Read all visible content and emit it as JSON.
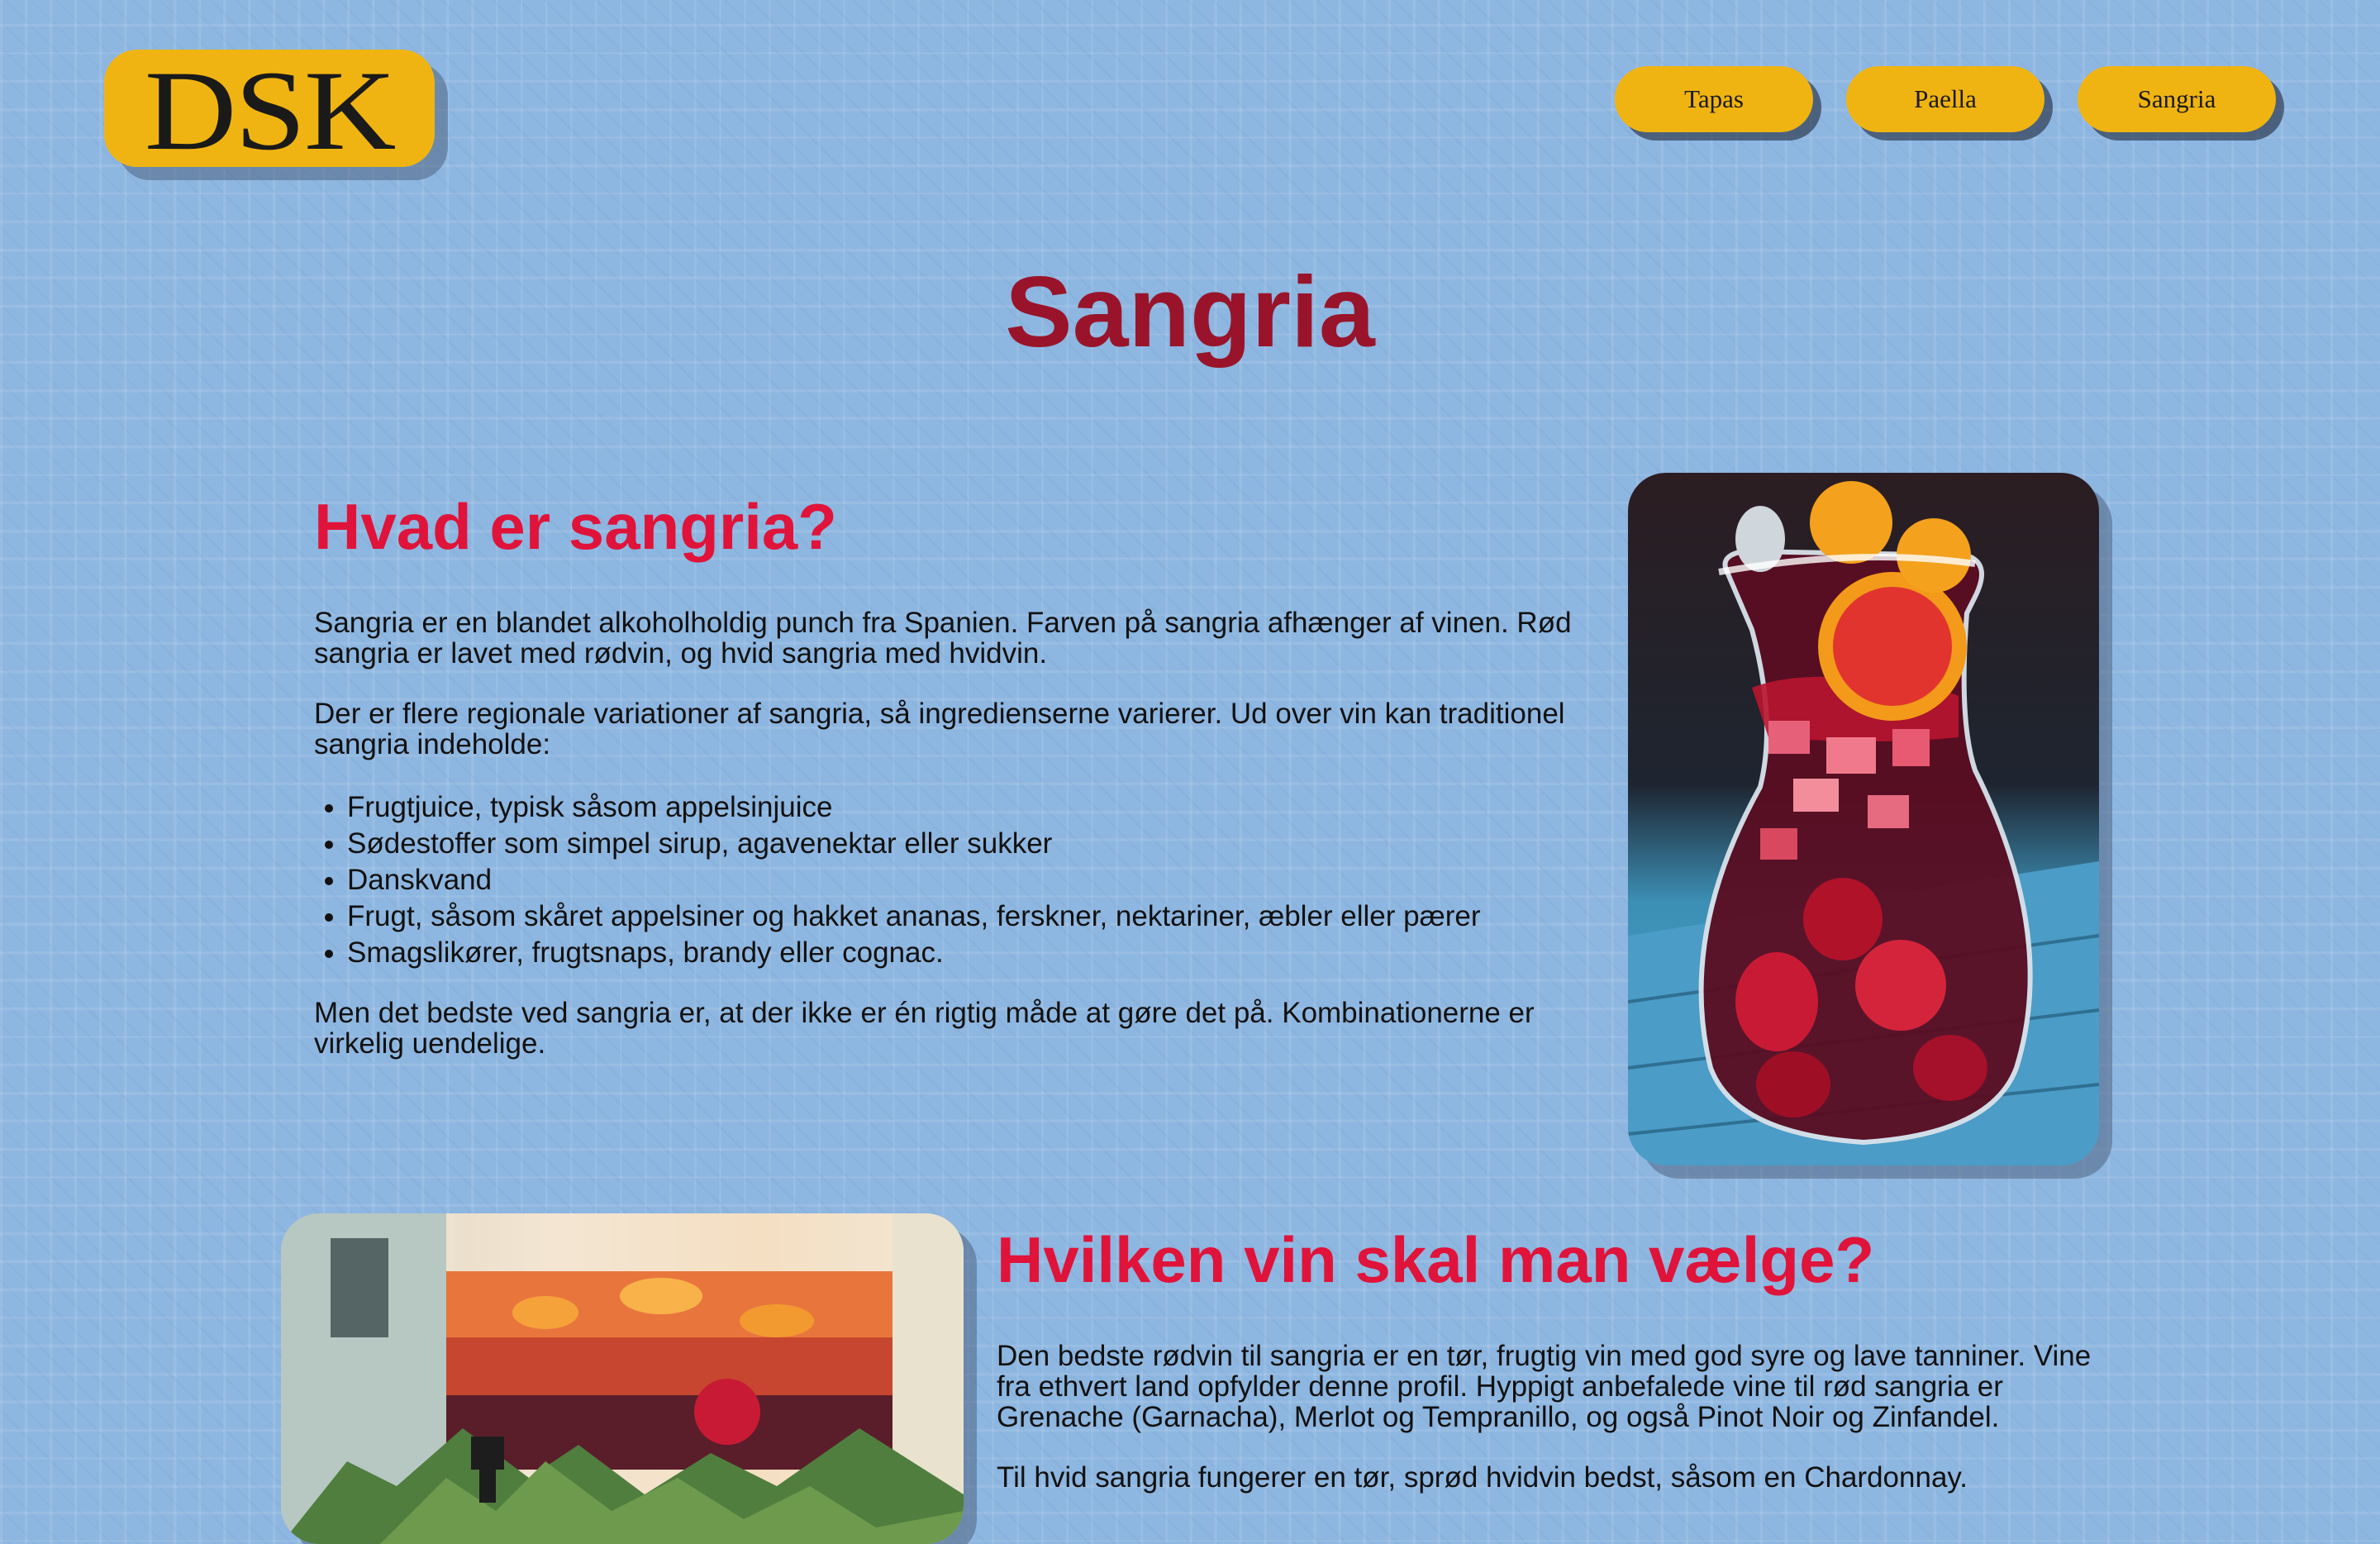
{
  "header": {
    "logo_text": "DSK",
    "nav": [
      {
        "label": "Tapas"
      },
      {
        "label": "Paella"
      },
      {
        "label": "Sangria"
      }
    ]
  },
  "page": {
    "title": "Sangria"
  },
  "section1": {
    "heading": "Hvad er sangria?",
    "paragraph1": "Sangria er en blandet alkoholholdig punch fra Spanien. Farven på sangria afhænger af vinen. Rød sangria er lavet med rødvin, og hvid sangria med hvidvin.",
    "paragraph2": "Der er flere regionale variationer af sangria, så ingredienserne varierer. Ud over vin kan traditionel sangria indeholde:",
    "list": [
      "Frugtjuice, typisk såsom appelsinjuice",
      "Sødestoffer som simpel sirup, agavenektar eller sukker",
      "Danskvand",
      "Frugt, såsom skåret appelsiner og hakket ananas, ferskner, nektariner, æbler eller pærer",
      "Smagslikører, frugtsnaps, brandy eller cognac."
    ],
    "paragraph3": "Men det bedste ved sangria er, at der ikke er én rigtig måde at gøre det på. Kombinationerne er virkelig uendelige."
  },
  "section2": {
    "heading": "Hvilken vin skal man vælge?",
    "paragraph1": "Den bedste rødvin til sangria er en tør, frugtig vin med god syre og lave tanniner. Vine fra ethvert land opfylder denne profil. Hyppigt anbefalede vine til rød sangria er Grenache (Garnacha), Merlot og Tempranillo, og også Pinot Noir og Zinfandel.",
    "paragraph2": "Til hvid sangria fungerer en tør, sprød hvidvin bedst, såsom en Chardonnay."
  }
}
